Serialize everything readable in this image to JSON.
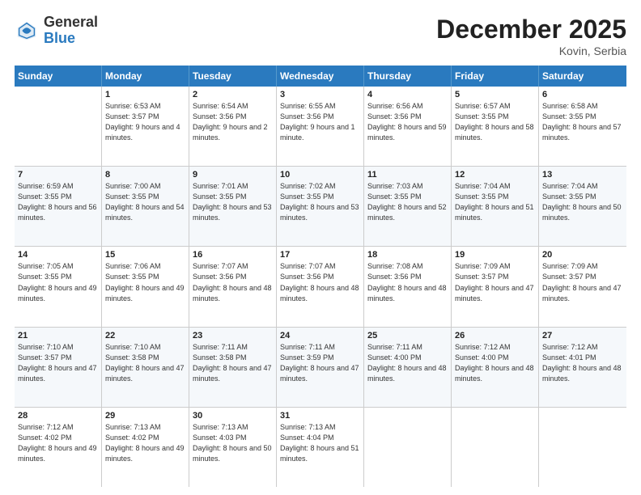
{
  "header": {
    "logo_general": "General",
    "logo_blue": "Blue",
    "month_title": "December 2025",
    "subtitle": "Kovin, Serbia"
  },
  "days_of_week": [
    "Sunday",
    "Monday",
    "Tuesday",
    "Wednesday",
    "Thursday",
    "Friday",
    "Saturday"
  ],
  "weeks": [
    [
      {
        "day": "",
        "sunrise": "",
        "sunset": "",
        "daylight": ""
      },
      {
        "day": "1",
        "sunrise": "Sunrise: 6:53 AM",
        "sunset": "Sunset: 3:57 PM",
        "daylight": "Daylight: 9 hours and 4 minutes."
      },
      {
        "day": "2",
        "sunrise": "Sunrise: 6:54 AM",
        "sunset": "Sunset: 3:56 PM",
        "daylight": "Daylight: 9 hours and 2 minutes."
      },
      {
        "day": "3",
        "sunrise": "Sunrise: 6:55 AM",
        "sunset": "Sunset: 3:56 PM",
        "daylight": "Daylight: 9 hours and 1 minute."
      },
      {
        "day": "4",
        "sunrise": "Sunrise: 6:56 AM",
        "sunset": "Sunset: 3:56 PM",
        "daylight": "Daylight: 8 hours and 59 minutes."
      },
      {
        "day": "5",
        "sunrise": "Sunrise: 6:57 AM",
        "sunset": "Sunset: 3:55 PM",
        "daylight": "Daylight: 8 hours and 58 minutes."
      },
      {
        "day": "6",
        "sunrise": "Sunrise: 6:58 AM",
        "sunset": "Sunset: 3:55 PM",
        "daylight": "Daylight: 8 hours and 57 minutes."
      }
    ],
    [
      {
        "day": "7",
        "sunrise": "Sunrise: 6:59 AM",
        "sunset": "Sunset: 3:55 PM",
        "daylight": "Daylight: 8 hours and 56 minutes."
      },
      {
        "day": "8",
        "sunrise": "Sunrise: 7:00 AM",
        "sunset": "Sunset: 3:55 PM",
        "daylight": "Daylight: 8 hours and 54 minutes."
      },
      {
        "day": "9",
        "sunrise": "Sunrise: 7:01 AM",
        "sunset": "Sunset: 3:55 PM",
        "daylight": "Daylight: 8 hours and 53 minutes."
      },
      {
        "day": "10",
        "sunrise": "Sunrise: 7:02 AM",
        "sunset": "Sunset: 3:55 PM",
        "daylight": "Daylight: 8 hours and 53 minutes."
      },
      {
        "day": "11",
        "sunrise": "Sunrise: 7:03 AM",
        "sunset": "Sunset: 3:55 PM",
        "daylight": "Daylight: 8 hours and 52 minutes."
      },
      {
        "day": "12",
        "sunrise": "Sunrise: 7:04 AM",
        "sunset": "Sunset: 3:55 PM",
        "daylight": "Daylight: 8 hours and 51 minutes."
      },
      {
        "day": "13",
        "sunrise": "Sunrise: 7:04 AM",
        "sunset": "Sunset: 3:55 PM",
        "daylight": "Daylight: 8 hours and 50 minutes."
      }
    ],
    [
      {
        "day": "14",
        "sunrise": "Sunrise: 7:05 AM",
        "sunset": "Sunset: 3:55 PM",
        "daylight": "Daylight: 8 hours and 49 minutes."
      },
      {
        "day": "15",
        "sunrise": "Sunrise: 7:06 AM",
        "sunset": "Sunset: 3:55 PM",
        "daylight": "Daylight: 8 hours and 49 minutes."
      },
      {
        "day": "16",
        "sunrise": "Sunrise: 7:07 AM",
        "sunset": "Sunset: 3:56 PM",
        "daylight": "Daylight: 8 hours and 48 minutes."
      },
      {
        "day": "17",
        "sunrise": "Sunrise: 7:07 AM",
        "sunset": "Sunset: 3:56 PM",
        "daylight": "Daylight: 8 hours and 48 minutes."
      },
      {
        "day": "18",
        "sunrise": "Sunrise: 7:08 AM",
        "sunset": "Sunset: 3:56 PM",
        "daylight": "Daylight: 8 hours and 48 minutes."
      },
      {
        "day": "19",
        "sunrise": "Sunrise: 7:09 AM",
        "sunset": "Sunset: 3:57 PM",
        "daylight": "Daylight: 8 hours and 47 minutes."
      },
      {
        "day": "20",
        "sunrise": "Sunrise: 7:09 AM",
        "sunset": "Sunset: 3:57 PM",
        "daylight": "Daylight: 8 hours and 47 minutes."
      }
    ],
    [
      {
        "day": "21",
        "sunrise": "Sunrise: 7:10 AM",
        "sunset": "Sunset: 3:57 PM",
        "daylight": "Daylight: 8 hours and 47 minutes."
      },
      {
        "day": "22",
        "sunrise": "Sunrise: 7:10 AM",
        "sunset": "Sunset: 3:58 PM",
        "daylight": "Daylight: 8 hours and 47 minutes."
      },
      {
        "day": "23",
        "sunrise": "Sunrise: 7:11 AM",
        "sunset": "Sunset: 3:58 PM",
        "daylight": "Daylight: 8 hours and 47 minutes."
      },
      {
        "day": "24",
        "sunrise": "Sunrise: 7:11 AM",
        "sunset": "Sunset: 3:59 PM",
        "daylight": "Daylight: 8 hours and 47 minutes."
      },
      {
        "day": "25",
        "sunrise": "Sunrise: 7:11 AM",
        "sunset": "Sunset: 4:00 PM",
        "daylight": "Daylight: 8 hours and 48 minutes."
      },
      {
        "day": "26",
        "sunrise": "Sunrise: 7:12 AM",
        "sunset": "Sunset: 4:00 PM",
        "daylight": "Daylight: 8 hours and 48 minutes."
      },
      {
        "day": "27",
        "sunrise": "Sunrise: 7:12 AM",
        "sunset": "Sunset: 4:01 PM",
        "daylight": "Daylight: 8 hours and 48 minutes."
      }
    ],
    [
      {
        "day": "28",
        "sunrise": "Sunrise: 7:12 AM",
        "sunset": "Sunset: 4:02 PM",
        "daylight": "Daylight: 8 hours and 49 minutes."
      },
      {
        "day": "29",
        "sunrise": "Sunrise: 7:13 AM",
        "sunset": "Sunset: 4:02 PM",
        "daylight": "Daylight: 8 hours and 49 minutes."
      },
      {
        "day": "30",
        "sunrise": "Sunrise: 7:13 AM",
        "sunset": "Sunset: 4:03 PM",
        "daylight": "Daylight: 8 hours and 50 minutes."
      },
      {
        "day": "31",
        "sunrise": "Sunrise: 7:13 AM",
        "sunset": "Sunset: 4:04 PM",
        "daylight": "Daylight: 8 hours and 51 minutes."
      },
      {
        "day": "",
        "sunrise": "",
        "sunset": "",
        "daylight": ""
      },
      {
        "day": "",
        "sunrise": "",
        "sunset": "",
        "daylight": ""
      },
      {
        "day": "",
        "sunrise": "",
        "sunset": "",
        "daylight": ""
      }
    ]
  ]
}
